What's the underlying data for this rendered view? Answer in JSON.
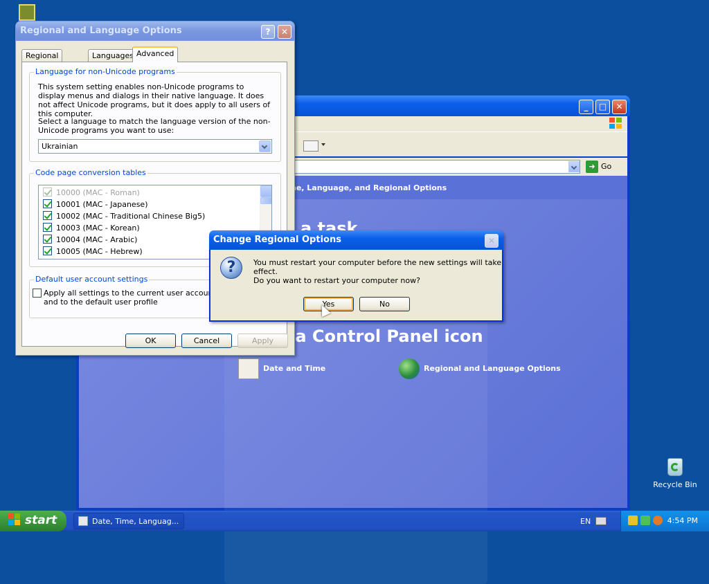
{
  "desktop": {
    "icons": [
      {
        "label": "Recycle Bin"
      }
    ]
  },
  "control_panel": {
    "header": "ne, Language, and Regional Options",
    "pick_task_text": "a task",
    "pick_icon_text": "k a Control Panel icon",
    "links": [
      {
        "label": "Date and Time"
      },
      {
        "label": "Regional and Language Options"
      }
    ],
    "go_label": "Go"
  },
  "regional_dialog": {
    "title": "Regional and Language Options",
    "help_btn": "?",
    "close_btn": "X",
    "tabs": [
      {
        "label": "Regional Options",
        "selected": false
      },
      {
        "label": "Languages",
        "selected": false
      },
      {
        "label": "Advanced",
        "selected": true
      }
    ],
    "non_unicode": {
      "legend": "Language for non-Unicode programs",
      "description": "This system setting enables non-Unicode programs to display menus and dialogs in their native language. It does not affect Unicode programs, but it does apply to all users of this computer.",
      "select_prompt": "Select a language to match the language version of the non-Unicode programs you want to use:",
      "selected_language": "Ukrainian"
    },
    "code_page": {
      "legend": "Code page conversion tables",
      "items": [
        {
          "label": "10000 (MAC - Roman)",
          "checked": true,
          "disabled": true
        },
        {
          "label": "10001 (MAC - Japanese)",
          "checked": true,
          "disabled": false
        },
        {
          "label": "10002 (MAC - Traditional Chinese Big5)",
          "checked": true,
          "disabled": false
        },
        {
          "label": "10003 (MAC - Korean)",
          "checked": true,
          "disabled": false
        },
        {
          "label": "10004 (MAC - Arabic)",
          "checked": true,
          "disabled": false
        },
        {
          "label": "10005 (MAC - Hebrew)",
          "checked": true,
          "disabled": false
        }
      ]
    },
    "default_user": {
      "legend": "Default user account settings",
      "checkbox_label": "Apply all settings to the current user account and to the default user profile",
      "checked": false
    },
    "buttons": {
      "ok": "OK",
      "cancel": "Cancel",
      "apply": "Apply"
    }
  },
  "message_dialog": {
    "title": "Change Regional Options",
    "line1": "You must restart your computer before the new settings will take effect.",
    "line2": "Do you want to restart your computer now?",
    "yes": "Yes",
    "no": "No"
  },
  "taskbar": {
    "start_label": "start",
    "task_label": "Date, Time, Languag...",
    "language": "EN",
    "clock": "4:54 PM"
  }
}
